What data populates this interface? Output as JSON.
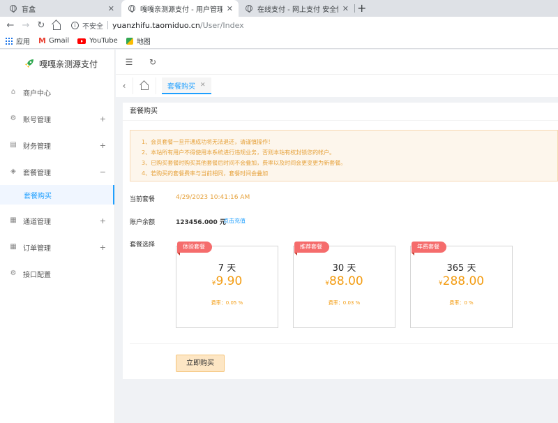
{
  "browser": {
    "tabs": [
      {
        "title": "盲盒"
      },
      {
        "title": "嘎嘎亲测源支付 - 用户管理中心"
      },
      {
        "title": "在线支付 - 网上支付 安全快速！"
      }
    ],
    "insecure_label": "不安全",
    "url_host": "yuanzhifu.taomiduo.cn",
    "url_path": "/User/Index",
    "bookmarks": [
      "应用",
      "Gmail",
      "YouTube",
      "地图"
    ]
  },
  "sidebar": {
    "logo": "嘎嘎亲测源支付",
    "items": [
      {
        "label": "商户中心",
        "toggle": ""
      },
      {
        "label": "账号管理",
        "toggle": "+"
      },
      {
        "label": "财务管理",
        "toggle": "+"
      },
      {
        "label": "套餐管理",
        "toggle": "−"
      },
      {
        "label": "通道管理",
        "toggle": "+"
      },
      {
        "label": "订单管理",
        "toggle": "+"
      },
      {
        "label": "接口配置",
        "toggle": ""
      }
    ],
    "active_sub": "套餐购买"
  },
  "tabs": {
    "current": "套餐购买"
  },
  "card": {
    "header": "套餐购买",
    "notices": [
      "1、会员套餐一旦开通成功将无法退还，请谨慎操作！",
      "2、本站所有用户不得使用本系统进行违规业务，否则本站有权封锁您的帐户。",
      "3、已购买套餐时购买其他套餐后时间不会叠加，费率以及时间会更变更为新套餐。",
      "4、若购买的套餐费率与当前相同，套餐时间会叠加"
    ],
    "current_label": "当前套餐",
    "current_value": "4/29/2023 10:41:16 AM",
    "balance_label": "账户余额",
    "balance_value": "123456.000 元",
    "recharge_link": "点击充值",
    "choose_label": "套餐选择",
    "packages": [
      {
        "tag": "体验套餐",
        "days": "7 天",
        "currency": "¥",
        "price": "9.90",
        "rate": "费率：0.05 %"
      },
      {
        "tag": "推荐套餐",
        "days": "30 天",
        "currency": "¥",
        "price": "88.00",
        "rate": "费率：0.03 %"
      },
      {
        "tag": "年费套餐",
        "days": "365 天",
        "currency": "¥",
        "price": "288.00",
        "rate": "费率：0 %"
      }
    ],
    "buy_button": "立即购买"
  },
  "colors": {
    "accent": "#1e9fff",
    "warning": "#e6a23c",
    "ribbon": "#f56c6c"
  }
}
